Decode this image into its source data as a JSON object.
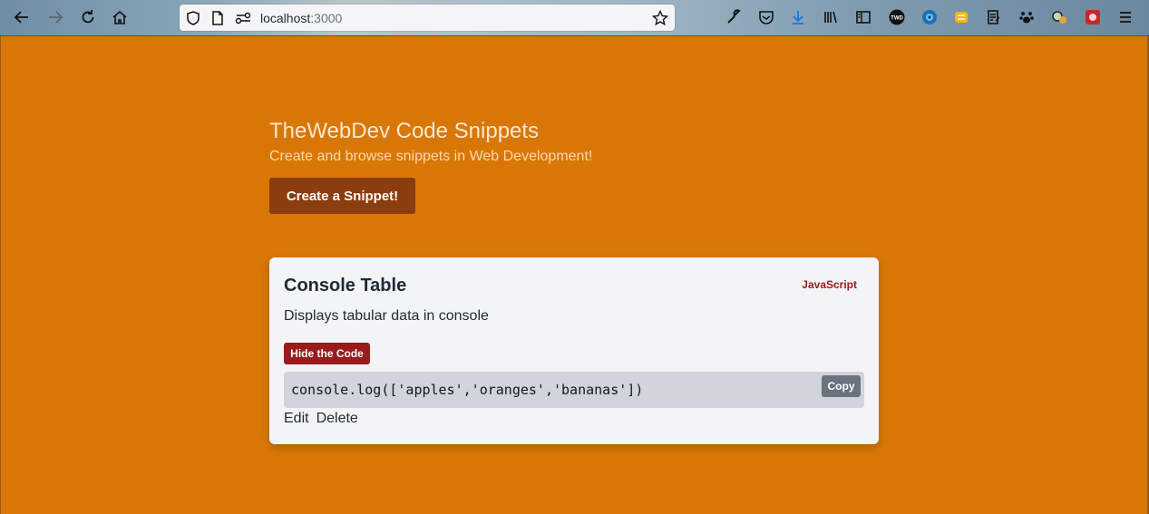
{
  "browser": {
    "url_host": "localhost",
    "url_port": ":3000"
  },
  "hero": {
    "title": "TheWebDev Code Snippets",
    "subtitle": "Create and browse snippets in Web Development!",
    "create_label": "Create a Snippet!"
  },
  "snippet": {
    "title": "Console Table",
    "language": "JavaScript",
    "description": "Displays tabular data in console",
    "hide_label": "Hide the Code",
    "code": "console.log(['apples','oranges','bananas'])",
    "copy_label": "Copy",
    "edit_label": "Edit",
    "delete_label": "Delete"
  },
  "icons": {
    "back": "back-arrow-icon",
    "forward": "forward-arrow-icon",
    "reload": "reload-icon",
    "home": "home-icon",
    "shield": "shield-icon",
    "page": "page-icon",
    "permissions": "permissions-icon",
    "bookmark": "star-icon",
    "menu": "hamburger-menu-icon"
  },
  "colors": {
    "page_bg": "#d97706",
    "create_btn": "#8a3d0e",
    "accent_red": "#991b1b",
    "card_bg": "#f3f4f6",
    "code_bg": "#d1d5db"
  }
}
